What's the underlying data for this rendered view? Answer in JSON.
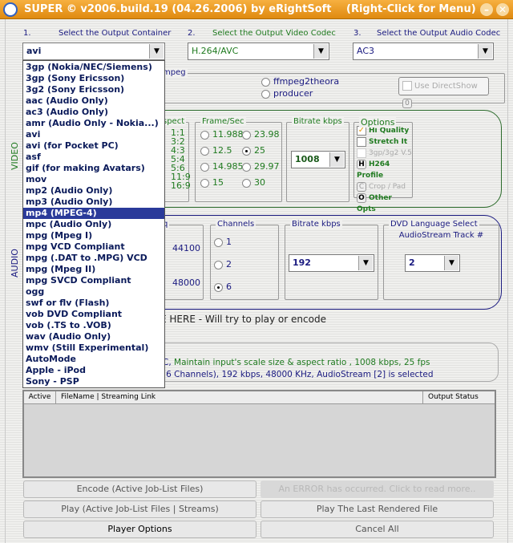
{
  "window": {
    "title": "SUPER © v2006.build.19 (04.26.2006) by eRightSoft",
    "hint": "(Right-Click for Menu)",
    "minimize": "–",
    "close": "✕"
  },
  "steps": [
    {
      "num": "1.",
      "label": "Select the Output Container",
      "value": "avi"
    },
    {
      "num": "2.",
      "label": "Select the Output Video Codec",
      "value": "H.264/AVC"
    },
    {
      "num": "3.",
      "label": "Select the Output Audio Codec",
      "value": "AC3"
    }
  ],
  "container_options": [
    "3gp  (Nokia/NEC/Siemens)",
    "3gp  (Sony Ericsson)",
    "3g2  (Sony Ericsson)",
    "aac  (Audio Only)",
    "ac3  (Audio Only)",
    "amr  (Audio Only - Nokia...)",
    "avi",
    "avi  (for Pocket PC)",
    "asf",
    "gif  (for making Avatars)",
    "mov",
    "mp2  (Audio Only)",
    "mp3  (Audio Only)",
    "mp4  (MPEG-4)",
    "mpc  (Audio Only)",
    "mpg  (Mpeg I)",
    "mpg  VCD Compliant",
    "mpg  (.DAT to .MPG) VCD",
    "mpg  (Mpeg II)",
    "mpg  SVCD Compliant",
    "ogg",
    "swf or flv (Flash)",
    "vob  DVD Compliant",
    "vob  (.TS to .VOB)",
    "wav (Audio Only)",
    "wmv  (Still Experimental)",
    "AutoMode",
    "Apple - iPod",
    "Sony - PSP"
  ],
  "highlighted_option": "mp4  (MPEG-4)",
  "encoder": {
    "group_label": "mpeg",
    "radios": [
      "ffmpeg2theora",
      "producer"
    ],
    "directshow_label": "Use DirectShow",
    "directshow_count": "0"
  },
  "video": {
    "section_label": "VIDEO",
    "aspect_label": "spect",
    "aspects": [
      "1:1",
      "3:2",
      "4:3",
      "5:4",
      "5:6",
      "11:9",
      "16:9"
    ],
    "fps_label": "Frame/Sec",
    "fps": [
      "11.988",
      "23.98",
      "12.5",
      "25",
      "14.985",
      "29.97",
      "15",
      "30"
    ],
    "fps_selected": "25",
    "bitrate_label": "Bitrate  kbps",
    "bitrate": "1008",
    "options_label": "Options",
    "hi_quality": "Hi Quality",
    "stretch": "Stretch It",
    "v5": "3gp/3g2 V.5",
    "h264_key": "H",
    "h264": "H264 Profile",
    "crop_key": "C",
    "crop": "Crop / Pad",
    "other_key": "O",
    "other": "Other Opts",
    "hi_quality_checked": true
  },
  "audio": {
    "section_label": "AUDIO",
    "freq_label": "q",
    "freqs": [
      "44100",
      "48000"
    ],
    "channels_label": "Channels",
    "channels": [
      "1",
      "2",
      "6"
    ],
    "channels_selected": "6",
    "bitrate_label": "Bitrate  kbps",
    "bitrate": "192",
    "dvd_label": "DVD Language Select",
    "track_label": "AudioStream  Track #",
    "track": "2"
  },
  "drop_hint": "E HERE - Will try to play or encode",
  "info": {
    "line1_prefix": "C,",
    "line1": "Maintain input's scale size & aspect ratio ,  1008 kbps,  25 fps",
    "line2": "(6 Channels),  192 kbps,  48000 KHz,  AudioStream [2] is selected"
  },
  "joblist": {
    "columns": [
      "Active",
      "FileName  |  Streaming Link",
      "Output  Status"
    ]
  },
  "buttons": {
    "encode": "Encode (Active Job-List Files)",
    "error": "An ERROR has occurred. Click to read more..",
    "play": "Play (Active Job-List Files | Streams)",
    "play_last": "Play The Last Rendered File",
    "player_options": "Player Options",
    "cancel_all": "Cancel All"
  }
}
